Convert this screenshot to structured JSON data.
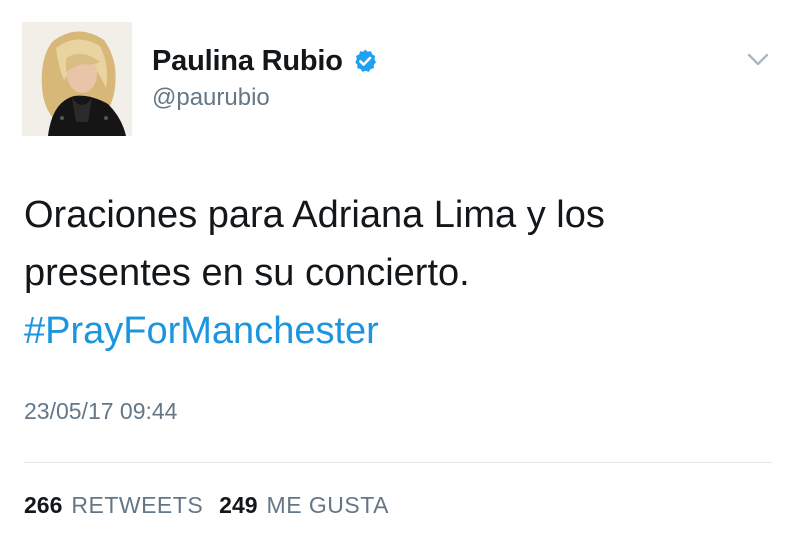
{
  "user": {
    "display_name": "Paulina Rubio",
    "handle": "@paurubio",
    "verified_icon": "verified-badge-icon"
  },
  "tweet": {
    "text_line_1": "Oraciones para Adriana Lima y los",
    "text_line_2": "presentes en su concierto.",
    "hashtag": "#PrayForManchester",
    "timestamp": "23/05/17 09:44"
  },
  "stats": {
    "retweets_count": "266",
    "retweets_label": "RETWEETS",
    "likes_count": "249",
    "likes_label": "ME GUSTA"
  },
  "colors": {
    "link": "#1b95e0",
    "verified": "#1da1f2",
    "secondary_text": "#657786",
    "primary_text": "#14171a"
  }
}
